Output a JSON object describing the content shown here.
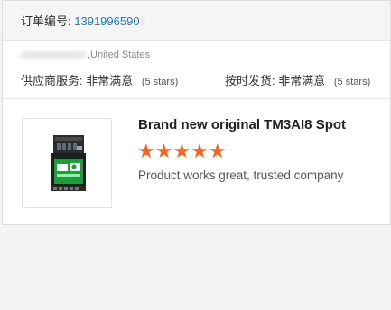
{
  "order": {
    "label": "订单编号:",
    "number_visible": "1391996590",
    "number_faded": "1"
  },
  "buyer": {
    "location": ",United States"
  },
  "ratings": {
    "supplier_service": {
      "label": "供应商服务:",
      "value": "非常满意",
      "stars_text": "(5 stars)"
    },
    "on_time_delivery": {
      "label": "按时发货:",
      "value": "非常满意",
      "stars_text": "(5 stars)"
    }
  },
  "product": {
    "title": "Brand new original TM3AI8 Spot",
    "stars": "★★★★★",
    "rating": 5,
    "rating_max": 5,
    "review": "Product works great, trusted company",
    "star_color": "#f26522"
  },
  "colors": {
    "link": "#1a7fc1"
  }
}
